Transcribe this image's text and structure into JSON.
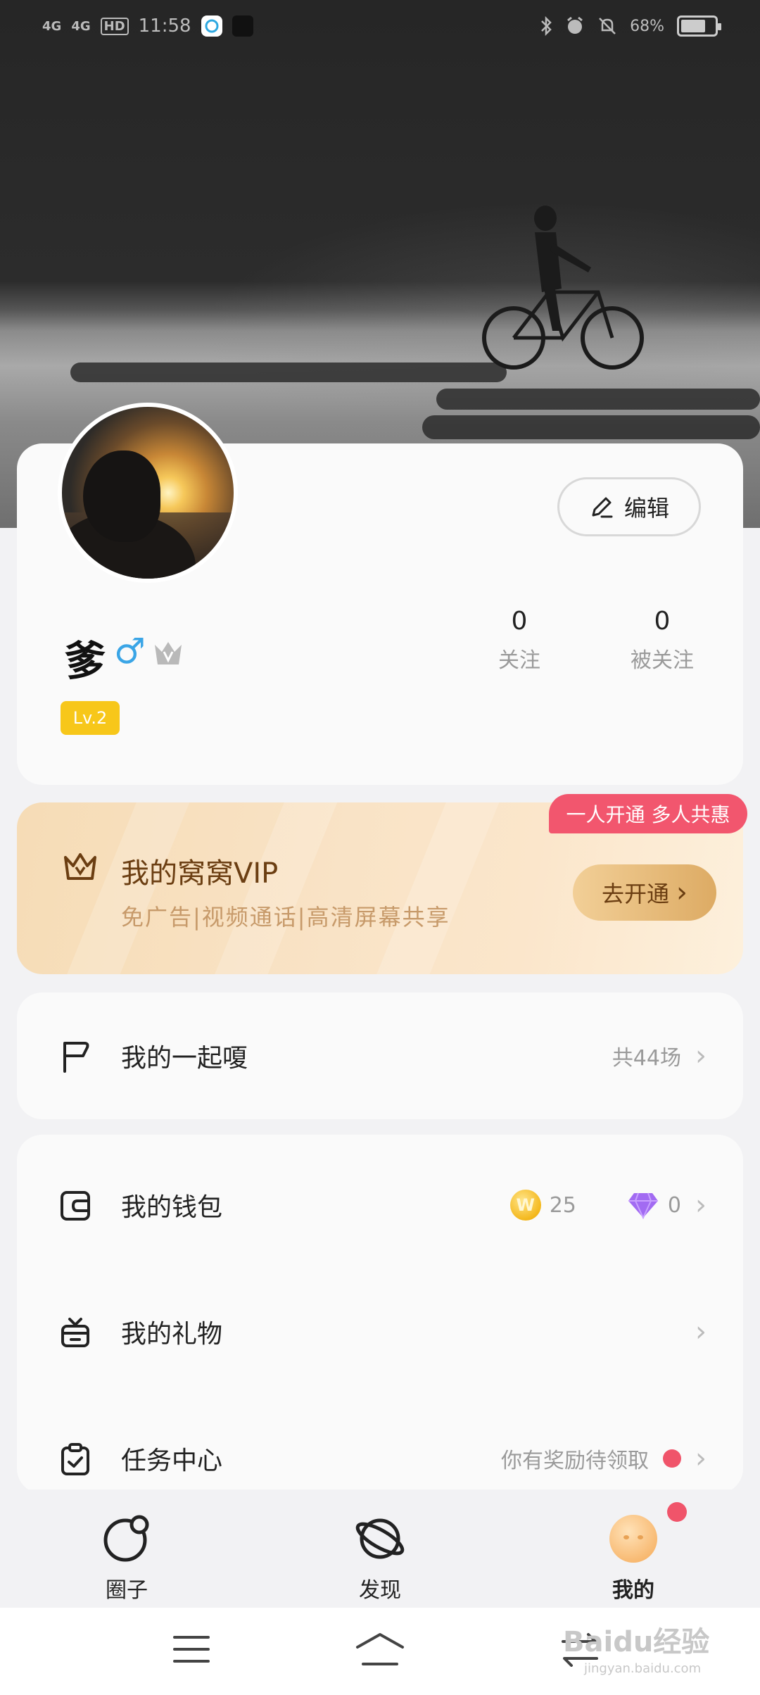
{
  "status_bar": {
    "signal_1": "4G",
    "signal_2": "4G",
    "hd": "HD",
    "time": "11:58",
    "battery": "68%"
  },
  "profile": {
    "edit_label": "编辑",
    "username": "爹",
    "gender_symbol": "♂",
    "level": "Lv.2",
    "following_count": "0",
    "following_label": "关注",
    "followers_count": "0",
    "followers_label": "被关注"
  },
  "vip": {
    "promo_tag": "一人开通 多人共惠",
    "title": "我的窝窝VIP",
    "subtitle": "免广告|视频通话|高清屏幕共享",
    "open_label": "去开通",
    "open_chevron": "›"
  },
  "menu": {
    "together": {
      "label": "我的一起嗄",
      "right": "共44场"
    },
    "wallet": {
      "label": "我的钱包",
      "coins": "25",
      "coin_glyph": "W",
      "diamonds": "0"
    },
    "gifts": {
      "label": "我的礼物"
    },
    "tasks": {
      "label": "任务中心",
      "right": "你有奖励待领取"
    },
    "chevron": "›"
  },
  "tabbar": {
    "circle": "圈子",
    "discover": "发现",
    "me": "我的"
  },
  "colors": {
    "accent_red": "#f0546a",
    "vip_gold": "#ddab64",
    "level_yellow": "#f7c71a",
    "male_blue": "#3aa5e6"
  },
  "icons": [
    "signal-icon",
    "bluetooth-icon",
    "alarm-icon",
    "mute-icon",
    "battery-icon",
    "edit-pencil-icon",
    "crown-icon",
    "flag-icon",
    "wallet-icon",
    "gift-icon",
    "task-clipboard-icon",
    "coin-icon",
    "diamond-icon",
    "planet-icon",
    "menu-icon",
    "home-icon",
    "back-icon"
  ],
  "watermark": {
    "text": "Baidu经验",
    "sub": "jingyan.baidu.com"
  }
}
